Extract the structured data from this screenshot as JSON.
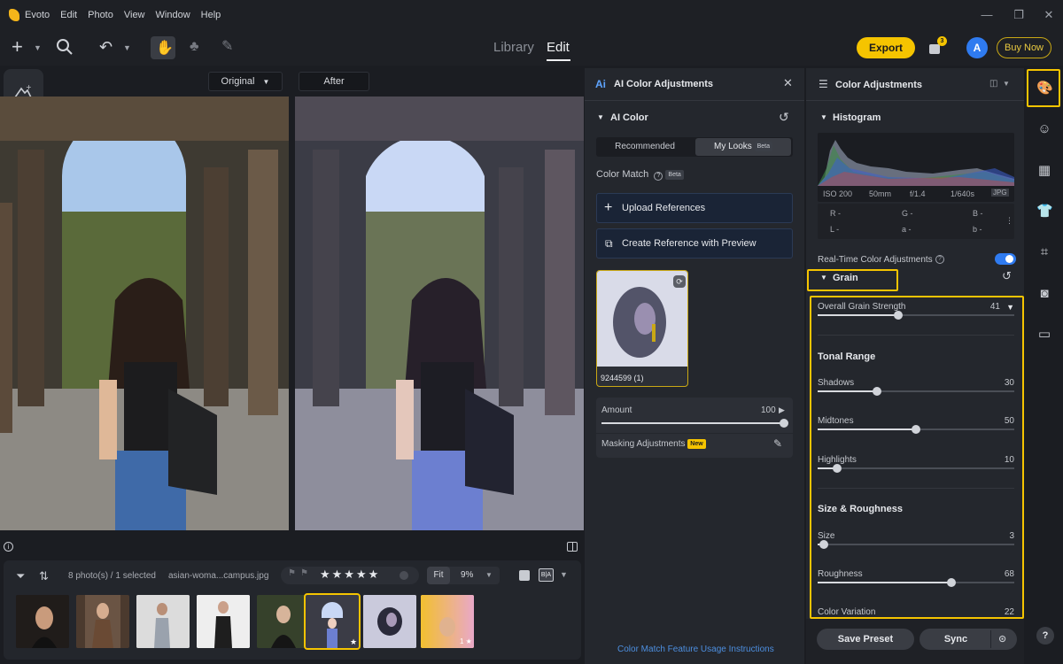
{
  "menubar": {
    "app": "Evoto",
    "items": [
      "Edit",
      "Photo",
      "View",
      "Window",
      "Help"
    ]
  },
  "toolbar": {
    "library_tab": "Library",
    "edit_tab": "Edit",
    "export_label": "Export",
    "badge_count": "3",
    "avatar_letter": "A",
    "buy_now_label": "Buy Now"
  },
  "viewer": {
    "original_label": "Original",
    "after_label": "After"
  },
  "filmstrip": {
    "count_label": "8 photo(s) / 1 selected",
    "filename": "asian-woma...campus.jpg",
    "fit_label": "Fit",
    "zoom_label": "9%",
    "ba_label": "B|A",
    "thumb_star_count": "1"
  },
  "ai_panel": {
    "title": "AI Color Adjustments",
    "ai_color_label": "AI Color",
    "tab_recommended": "Recommended",
    "tab_my_looks": "My Looks",
    "beta_label": "Beta",
    "color_match_label": "Color Match",
    "upload_label": "Upload References",
    "create_label": "Create Reference with Preview",
    "reference_name": "9244599 (1)",
    "amount_label": "Amount",
    "amount_value": "100",
    "amount_level": 1.0,
    "masking_label": "Masking Adjustments",
    "new_label": "New",
    "footer_link": "Color Match Feature Usage Instructions"
  },
  "right_panel": {
    "title": "Color Adjustments",
    "histogram_label": "Histogram",
    "exif": {
      "iso": "ISO 200",
      "focal": "50mm",
      "aperture": "f/1.4",
      "shutter": "1/640s",
      "format": "JPG"
    },
    "color_readout": {
      "r": "R -",
      "g": "G -",
      "b": "B -",
      "l": "L -",
      "a": "a -",
      "bb": "b -"
    },
    "realtime_label": "Real-Time Color Adjustments",
    "grain_label": "Grain",
    "overall_label": "Overall Grain Strength",
    "overall_value": "41",
    "overall_level": 0.41,
    "tonal_range_label": "Tonal Range",
    "shadows_label": "Shadows",
    "shadows_value": "30",
    "shadows_level": 0.3,
    "midtones_label": "Midtones",
    "midtones_value": "50",
    "midtones_level": 0.5,
    "highlights_label": "Highlights",
    "highlights_value": "10",
    "highlights_level": 0.1,
    "size_roughness_label": "Size & Roughness",
    "size_label": "Size",
    "size_value": "3",
    "size_level": 0.03,
    "roughness_label": "Roughness",
    "roughness_value": "68",
    "roughness_level": 0.68,
    "color_variation_label": "Color Variation",
    "color_variation_value": "22",
    "save_preset_label": "Save Preset",
    "sync_label": "Sync"
  },
  "colors": {
    "accent_yellow": "#f5c400",
    "toggle_blue": "#2f7bf0",
    "panel_bg": "#24272d"
  }
}
